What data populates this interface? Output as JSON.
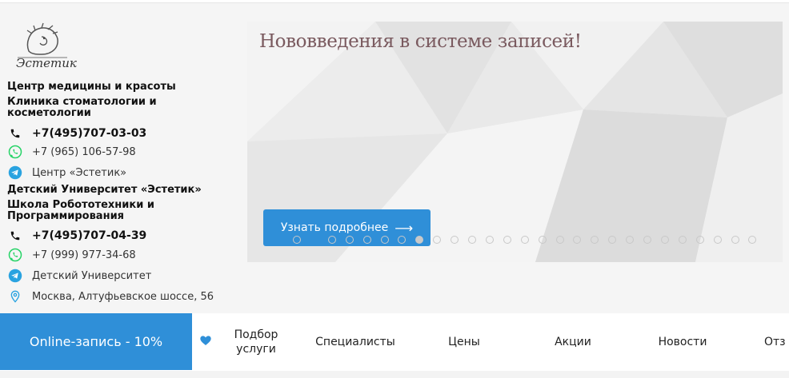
{
  "logo": {
    "text": "Эстетик"
  },
  "center1": {
    "title1": "Центр медицины и красоты",
    "title2": "Клиника стоматологии и косметологии",
    "phone": "+7(495)707-03-03",
    "whatsapp": "+7 (965) 106-57-98",
    "telegram": "Центр «Эстетик»"
  },
  "center2": {
    "title1": "Детский Университет «Эстетик»",
    "title2": "Школа Робототехники и Программирования",
    "phone": "+7(495)707-04-39",
    "whatsapp": "+7 (999) 977-34-68",
    "telegram": "Детский Университет",
    "address": "Москва, Алтуфьевское шоссе, 56"
  },
  "banner": {
    "title": "Нововведения в системе записей!",
    "button_label": "Узнать подробнее",
    "slide_count": 27,
    "active_slide": 7
  },
  "nav": {
    "online_label": "Online-запись - 10%",
    "items": [
      {
        "label": "Подбор услуги"
      },
      {
        "label": "Специалисты"
      },
      {
        "label": "Цены"
      },
      {
        "label": "Акции"
      },
      {
        "label": "Новости"
      },
      {
        "label": "Отз"
      }
    ]
  },
  "colors": {
    "accent": "#2f8fd8",
    "banner_title": "#7a5a5f",
    "whatsapp": "#25d366",
    "telegram": "#2aa3e0"
  }
}
